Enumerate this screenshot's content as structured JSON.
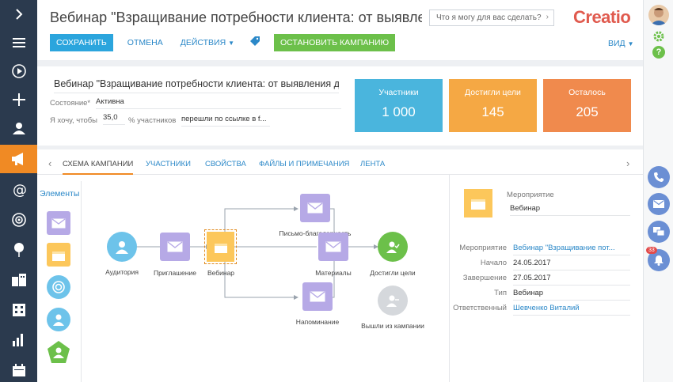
{
  "header": {
    "title": "Вебинар \"Взращивание потребности клиента: от выявлен...",
    "search_placeholder": "Что я могу для вас сделать?",
    "logo": "Creatio"
  },
  "toolbar": {
    "save_label": "СОХРАНИТЬ",
    "cancel_label": "ОТМЕНА",
    "actions_label": "ДЕЙСТВИЯ",
    "stop_label": "ОСТАНОВИТЬ КАМПАНИЮ",
    "view_label": "ВИД"
  },
  "info": {
    "campaign_name": "Вебинар \"Взращивание потребности клиента: от выявления до п...",
    "state_label": "Состояние*",
    "state_value": "Активна",
    "goal_label": "Я хочу, чтобы",
    "goal_percent": "35,0",
    "goal_suffix": "% участников",
    "goal_condition": "перешли по ссылке в f..."
  },
  "stats": [
    {
      "title": "Участники",
      "value": "1 000",
      "color": "#4ab5dd"
    },
    {
      "title": "Достигли цели",
      "value": "145",
      "color": "#f5a844"
    },
    {
      "title": "Осталось",
      "value": "205",
      "color": "#f08a4d"
    }
  ],
  "tabs": {
    "scheme": "СХЕМА КАМПАНИИ",
    "participants": "УЧАСТНИКИ",
    "properties": "СВОЙСТВА",
    "files": "ФАЙЛЫ И ПРИМЕЧАНИЯ",
    "feed": "ЛЕНТА"
  },
  "palette": {
    "title": "Элементы",
    "items": [
      "email-icon",
      "calendar-icon",
      "target-icon",
      "person-icon",
      "exit-icon"
    ]
  },
  "diagram": {
    "audience": "Аудитория",
    "invitation": "Приглашение",
    "webinar": "Вебинар",
    "thanks": "Письмо-благодарность",
    "reminder": "Напоминание",
    "materials": "Материалы",
    "goal": "Достигли цели",
    "exited": "Вышли из кампании"
  },
  "details": {
    "header_label": "Мероприятие",
    "header_value": "Вебинар",
    "rows": [
      {
        "label": "Мероприятие",
        "value": "Вебинар \"Взращивание пот..."
      },
      {
        "label": "Начало",
        "value": "24.05.2017"
      },
      {
        "label": "Завершение",
        "value": "27.05.2017"
      },
      {
        "label": "Тип",
        "value": "Вебинар"
      },
      {
        "label": "Ответственный",
        "value": "Шевченко Виталий"
      }
    ]
  },
  "notifications": {
    "count": "33"
  },
  "colors": {
    "nav_bg": "#2b3a4e",
    "accent_orange": "#f08a24",
    "save_blue": "#2ba5dd",
    "stop_green": "#6cc04a",
    "email_purple": "#b6a9e6",
    "audience_blue": "#6dc3ea",
    "goal_green": "#6cc04a"
  }
}
